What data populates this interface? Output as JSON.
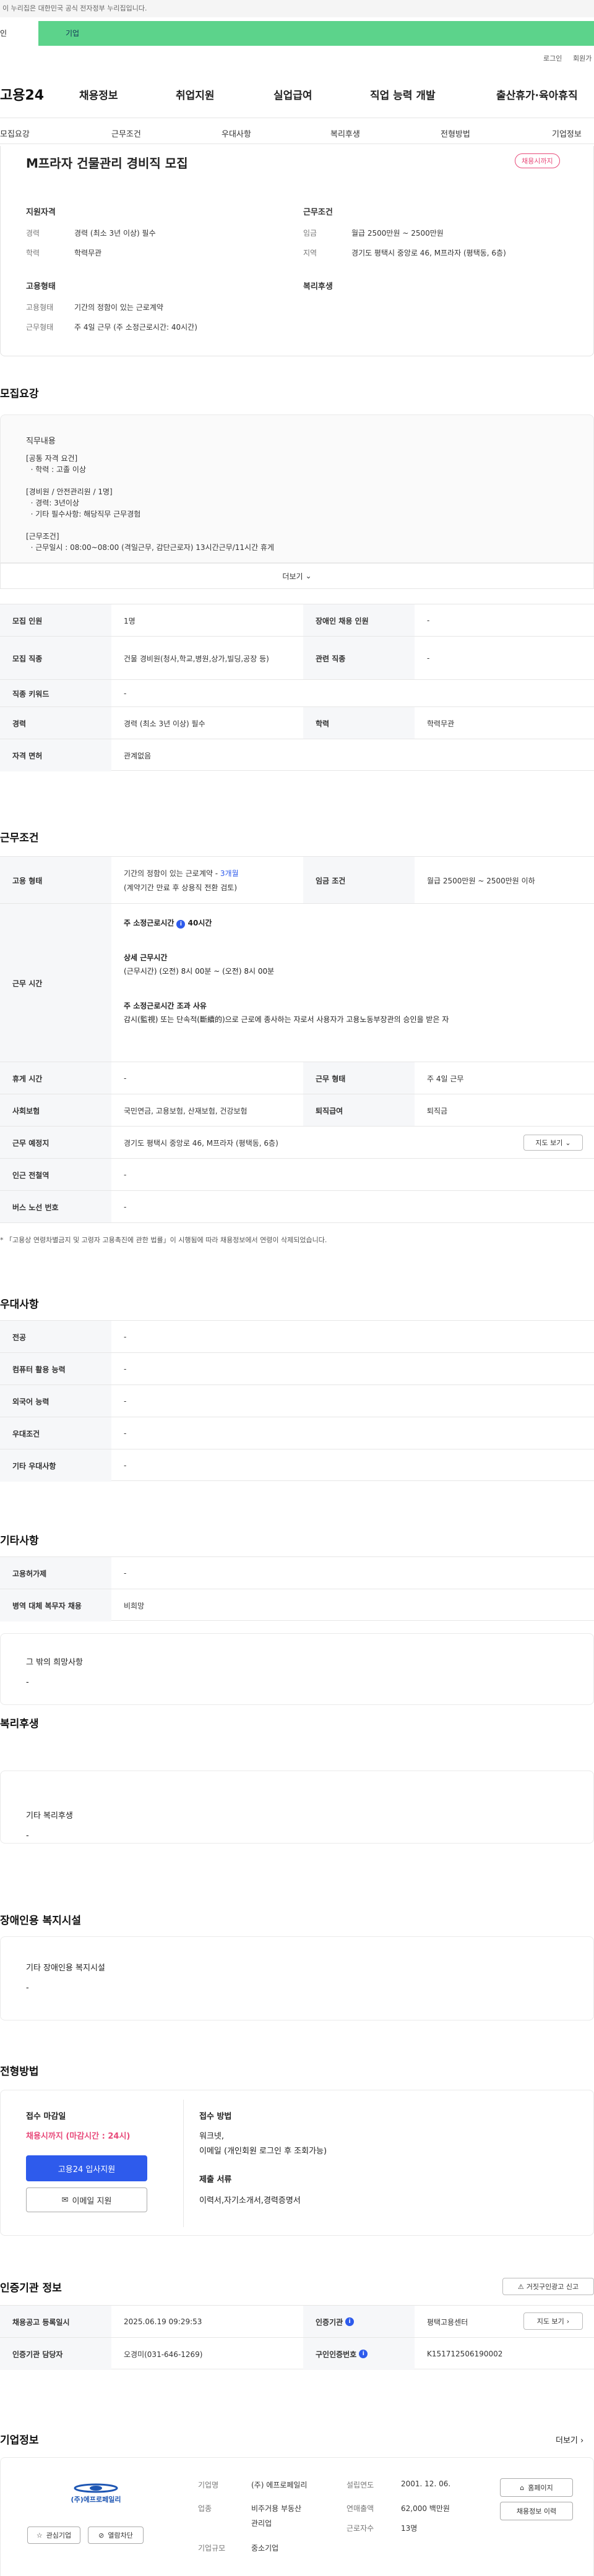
{
  "gov_bar": "이 누리집은 대한민국 공식 전자정부 누리집입니다.",
  "strip": {
    "left": "인",
    "right": "기업"
  },
  "util": {
    "login": "로그인",
    "join": "회원가"
  },
  "logo": "고용24",
  "gnb": [
    "채용정보",
    "취업지원",
    "실업급여",
    "직업 능력 개발",
    "출산휴가·육아휴직"
  ],
  "subnav": [
    "모집요강",
    "근무조건",
    "우대사항",
    "복리후생",
    "전형방법",
    "기업정보"
  ],
  "job": {
    "title": "M프라자 건물관리 경비직 모집",
    "badge": "채용시까지",
    "qual_title": "지원자격",
    "qual": [
      {
        "label": "경력",
        "value": "경력 (최소 3년 이상) 필수"
      },
      {
        "label": "학력",
        "value": "학력무관"
      }
    ],
    "work_title": "근무조건",
    "work": [
      {
        "label": "임금",
        "value": "월급 2500만원 ~ 2500만원"
      },
      {
        "label": "지역",
        "value": "경기도 평택시 중앙로 46, M프라자 (평택동, 6층)"
      }
    ],
    "emp_title": "고용형태",
    "emp": [
      {
        "label": "고용형태",
        "value": "기간의 정함이 있는 근로계약"
      },
      {
        "label": "근무형태",
        "value": "주 4일 근무 (주 소정근로시간: 40시간)"
      }
    ],
    "welfare_title": "복리후생"
  },
  "recruit": {
    "title": "모집요강",
    "box_title": "직무내용",
    "lines": [
      "[공통 자격 요건]",
      "  · 학력 : 고졸 이상",
      "",
      "[경비원 / 안전관리원 / 1명]",
      "  · 경력: 3년이상",
      "  · 기타 필수사항: 해당직무 근무경험",
      "",
      "[근무조건]",
      "  · 근무일시 : 08:00~08:00 (격일근무, 감단근로자) 13시간근무/11시간 휴게"
    ],
    "more": "더보기",
    "rows": [
      [
        {
          "th": "모집 인원",
          "td": "1명"
        },
        {
          "th": "장애인 채용 인원",
          "td": "-"
        }
      ],
      [
        {
          "th": "모집 직종",
          "td": "건물 경비원(청사,학교,병원,상가,빌딩,공장 등)"
        },
        {
          "th": "관련 직종",
          "td": "-"
        }
      ],
      [
        {
          "th": "직종 키워드",
          "td": "-"
        }
      ],
      [
        {
          "th": "경력",
          "td": "경력 (최소 3년 이상) 필수"
        },
        {
          "th": "학력",
          "td": "학력무관"
        }
      ],
      [
        {
          "th": "자격 면허",
          "td": "관계없음"
        }
      ]
    ]
  },
  "conditions": {
    "title": "근무조건",
    "emp_th": "고용 형태",
    "emp_td1": "기간의 정함이 있는 근로계약 -",
    "emp_period": "3개월",
    "emp_td2": "(계약기간 만료 후 상용직 전환 검토)",
    "wage_th": "임금 조건",
    "wage_td": "월급 2500만원 ~ 2500만원 이하",
    "hours_th": "근무 시간",
    "hours_h1": "주 소정근로시간",
    "hours_v1": "40시간",
    "hours_h2": "상세 근무시간",
    "hours_v2": "(근무시간) (오전) 8시 00분 ~ (오전) 8시 00분",
    "hours_h3": "주 소정근로시간 조과 사유",
    "hours_v3": "감시(監視) 또는 단속적(斷續的)으로 근로에 종사하는 자로서 사용자가 고용노동부장관의 승인을 받은 자",
    "rows2": [
      [
        {
          "th": "휴게 시간",
          "td": "-"
        },
        {
          "th": "근무 형태",
          "td": "주 4일 근무"
        }
      ],
      [
        {
          "th": "사회보험",
          "td": "국민연금, 고용보험, 산재보험, 건강보험"
        },
        {
          "th": "퇴직급여",
          "td": "퇴직금"
        }
      ]
    ],
    "loc_th": "근무 예정지",
    "loc_td": "경기도 평택시 중앙로 46, M프라자 (평택동, 6층)",
    "map_btn": "지도 보기",
    "rows3": [
      {
        "th": "인근 전철역",
        "td": "-"
      },
      {
        "th": "버스 노선 번호",
        "td": "-"
      }
    ],
    "note": "* 「고용상 연령차별금지 및 고령자 고용촉진에 관한 법률」이 시행됨에 따라 채용정보에서 연령이 삭제되었습니다."
  },
  "pref": {
    "title": "우대사항",
    "rows": [
      {
        "th": "전공",
        "td": "-"
      },
      {
        "th": "컴퓨터 활용 능력",
        "td": "-"
      },
      {
        "th": "외국어 능력",
        "td": "-"
      },
      {
        "th": "우대조건",
        "td": "-"
      },
      {
        "th": "기타 우대사항",
        "td": "-"
      }
    ]
  },
  "etc": {
    "title": "기타사항",
    "rows": [
      {
        "th": "고용허가제",
        "td": "-"
      },
      {
        "th": "병역 대체 복무자 채용",
        "td": "비희망"
      }
    ],
    "box_title": "그 밖의 희망사항",
    "box_val": "-"
  },
  "welfare": {
    "title": "복리후생",
    "box_title": "기타 복리후생",
    "box_val": "-"
  },
  "disab": {
    "title": "장애인용 복지시설",
    "box_title": "기타 장애인용 복지시설",
    "box_val": "-"
  },
  "process": {
    "title": "전형방법",
    "deadline_label": "접수 마감일",
    "deadline_value": "채용시까지 (마감시간 : 24시)",
    "apply_btn": "고용24 입사지원",
    "email_btn": "이메일 지원",
    "method_label": "접수 방법",
    "method_value1": "워크넷,",
    "method_value2": "이메일 (개인회원 로그인 후 조회가능)",
    "docs_label": "제출 서류",
    "docs_value": "이력서,자기소개서,경력증명서"
  },
  "cert": {
    "title": "인증기관 정보",
    "report_btn": "거짓구인광고 신고",
    "r1": {
      "th1": "채용공고 등록일시",
      "td1": "2025.06.19 09:29:53",
      "th2": "인증기관",
      "td2": "평택고용센터",
      "btn": "지도 보기"
    },
    "r2": {
      "th1": "인증기관 담당자",
      "td1": "오경미(031-646-1269)",
      "th2": "구인인증번호",
      "td2": "K151712506190002"
    }
  },
  "company": {
    "title": "기업정보",
    "more": "더보기",
    "logo_text": "(주)에프로페일리",
    "interest_btn": "관심기업",
    "block_btn": "열람차단",
    "name_label": "기업명",
    "name_value": "(주) 에프로페일리",
    "biz_label": "업종",
    "biz_value1": "비주거용 부동산",
    "biz_value2": "관리업",
    "size_label": "기업규모",
    "size_value": "중소기업",
    "est_label": "설립연도",
    "est_value": "2001. 12. 06.",
    "sales_label": "연매출액",
    "sales_value": "62,000 백만원",
    "emp_label": "근로자수",
    "emp_value": "13명",
    "home_btn": "홈페이지",
    "hire_btn": "채용정보 이력"
  }
}
